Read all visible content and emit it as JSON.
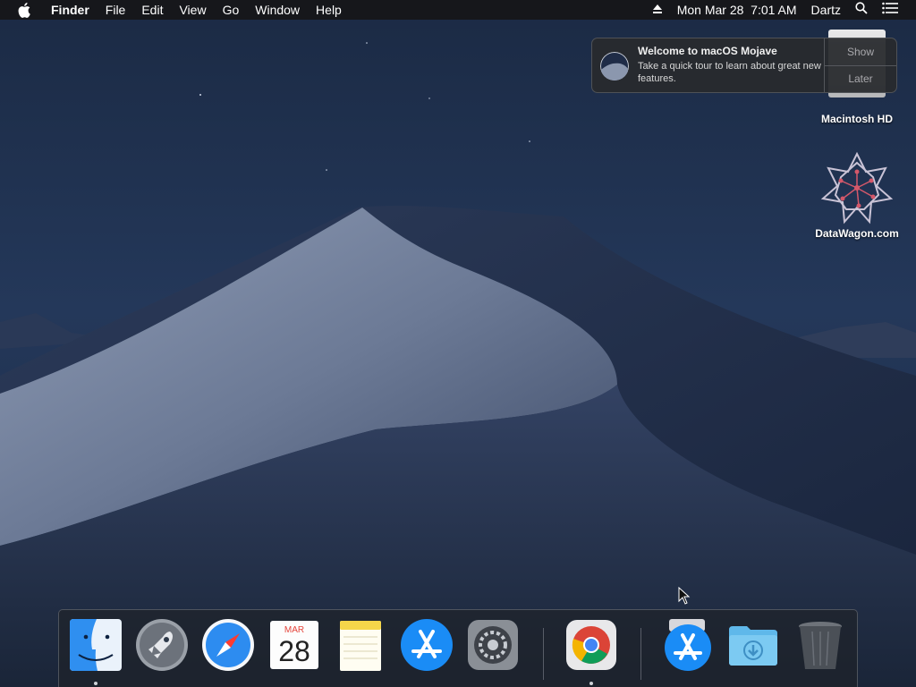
{
  "menubar": {
    "apple_icon": "apple-logo-icon",
    "app_name": "Finder",
    "menus": [
      "File",
      "Edit",
      "View",
      "Go",
      "Window",
      "Help"
    ],
    "clock": "Mon Mar 28  7:01 AM",
    "user": "Dartz",
    "icons": [
      "eject-icon",
      "spotlight-search-icon",
      "notification-center-icon"
    ]
  },
  "notification": {
    "title": "Welcome to macOS Mojave",
    "body": "Take a quick tour to learn about great new features.",
    "actions": {
      "show": "Show",
      "later": "Later"
    }
  },
  "desktop": {
    "icons": [
      {
        "label": "Macintosh HD",
        "icon": "hard-drive-icon"
      },
      {
        "label": "DataWagon.com",
        "icon": "datawagon-logo-icon"
      }
    ]
  },
  "dock": {
    "apps": [
      {
        "name": "Finder",
        "icon": "finder-icon",
        "running": true
      },
      {
        "name": "Launchpad",
        "icon": "launchpad-icon",
        "running": false
      },
      {
        "name": "Safari",
        "icon": "safari-icon",
        "running": false
      },
      {
        "name": "Calendar",
        "icon": "calendar-icon",
        "running": false,
        "month": "MAR",
        "day": "28"
      },
      {
        "name": "Notes",
        "icon": "notes-icon",
        "running": false
      },
      {
        "name": "App Store",
        "icon": "app-store-icon",
        "running": false
      },
      {
        "name": "System Preferences",
        "icon": "system-preferences-icon",
        "running": false
      },
      {
        "name": "Google Chrome",
        "icon": "chrome-icon",
        "running": true
      },
      {
        "name": "App Store Installer",
        "icon": "app-store-installer-icon",
        "running": false
      },
      {
        "name": "Downloads",
        "icon": "downloads-folder-icon",
        "running": false
      },
      {
        "name": "Trash",
        "icon": "trash-icon",
        "running": false
      }
    ]
  },
  "colors": {
    "menubar_bg": "#161618",
    "notification_bg": "#282a2e",
    "dock_bg": "#1e222a",
    "sky_top": "#1c2b45",
    "dune": "#7b89a3"
  }
}
